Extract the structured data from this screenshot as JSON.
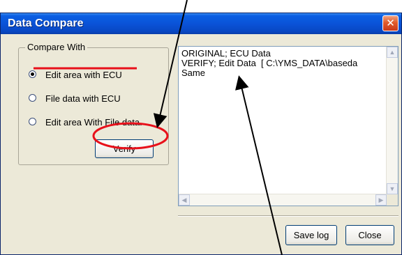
{
  "window": {
    "title": "Data Compare",
    "close_symbol": "✕"
  },
  "compare_group": {
    "label": "Compare With",
    "options": [
      {
        "label": "Edit area with ECU",
        "selected": true
      },
      {
        "label": "File data with ECU",
        "selected": false
      },
      {
        "label": "Edit area With File data.",
        "selected": false
      }
    ]
  },
  "verify_button": {
    "label": "Verify"
  },
  "output": {
    "lines": "ORIGINAL; ECU Data\nVERIFY; Edit Data  [ C:\\YMS_DATA\\baseda\nSame"
  },
  "buttons": {
    "save_log": "Save log",
    "close": "Close"
  },
  "annotation_color": "#e8101a"
}
